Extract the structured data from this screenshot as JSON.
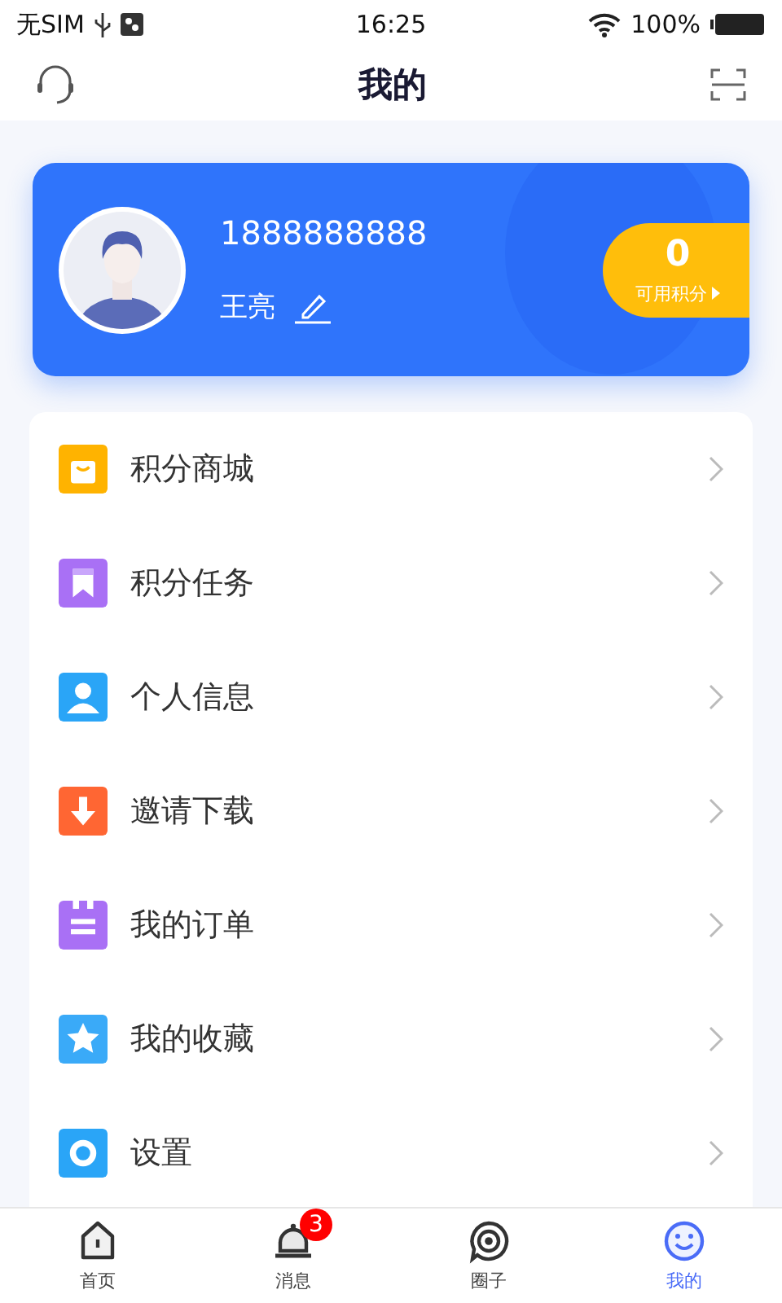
{
  "status_bar": {
    "carrier": "无SIM",
    "time": "16:25",
    "battery": "100%"
  },
  "nav_bar": {
    "title": "我的"
  },
  "profile": {
    "phone": "1888888888",
    "name": "王亮",
    "points": "0",
    "points_label": "可用积分"
  },
  "menu": [
    {
      "label": "积分商城",
      "color": "#ffb300"
    },
    {
      "label": "积分任务",
      "color": "#a970f5"
    },
    {
      "label": "个人信息",
      "color": "#2aa5f7"
    },
    {
      "label": "邀请下载",
      "color": "#ff6633"
    },
    {
      "label": "我的订单",
      "color": "#a970f5"
    },
    {
      "label": "我的收藏",
      "color": "#3aaaf8"
    },
    {
      "label": "设置",
      "color": "#2aa5f7"
    }
  ],
  "tab_bar": [
    {
      "label": "首页",
      "selected": false
    },
    {
      "label": "消息",
      "selected": false,
      "badge": "3"
    },
    {
      "label": "圈子",
      "selected": false
    },
    {
      "label": "我的",
      "selected": true
    }
  ]
}
